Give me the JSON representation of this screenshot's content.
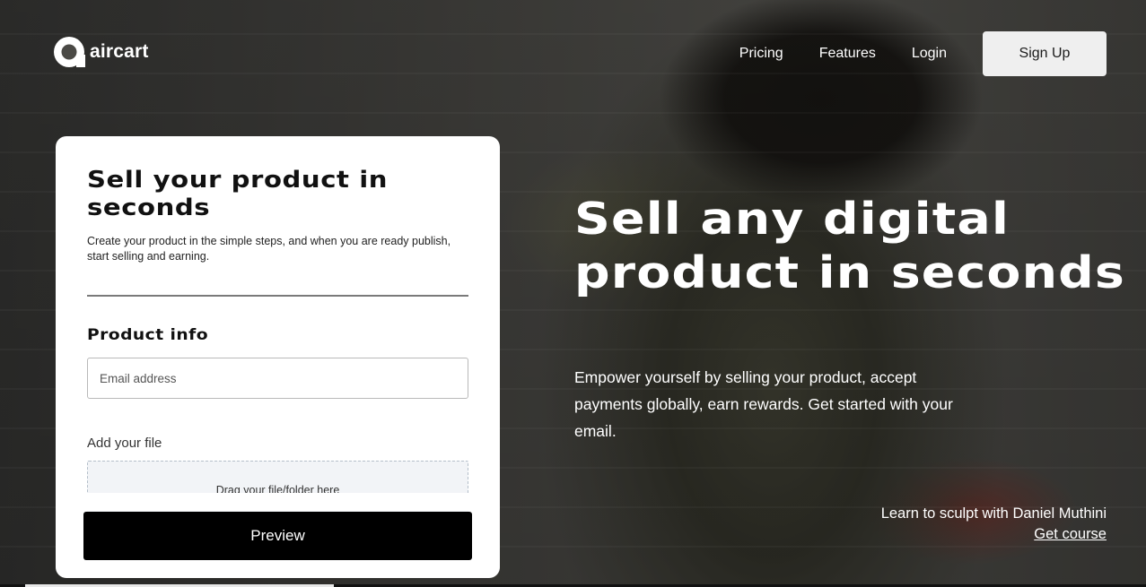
{
  "brand": {
    "name": "aircart",
    "icon": "aircart-logo-icon"
  },
  "nav": {
    "items": [
      {
        "label": "Pricing"
      },
      {
        "label": "Features"
      },
      {
        "label": "Login"
      }
    ],
    "signup_label": "Sign Up"
  },
  "form": {
    "title": "Sell your product in seconds",
    "subtitle": "Create your product in the simple steps, and when you are ready publish, start selling and earning.",
    "section_title": "Product info",
    "email_placeholder": "Email address",
    "email_value": "",
    "file_label": "Add your file",
    "dropzone_text": "Drag your file/folder here",
    "preview_label": "Preview"
  },
  "hero": {
    "title": "Sell any digital product in seconds",
    "subtitle": "Empower yourself by selling your product, accept payments globally, earn rewards. Get started with your email."
  },
  "credit": {
    "text": "Learn to sculpt with Daniel Muthini",
    "link_label": "Get course"
  },
  "colors": {
    "card_bg": "#ffffff",
    "button_dark": "#000000",
    "signup_bg": "#efefef",
    "text_light": "#ffffff"
  }
}
